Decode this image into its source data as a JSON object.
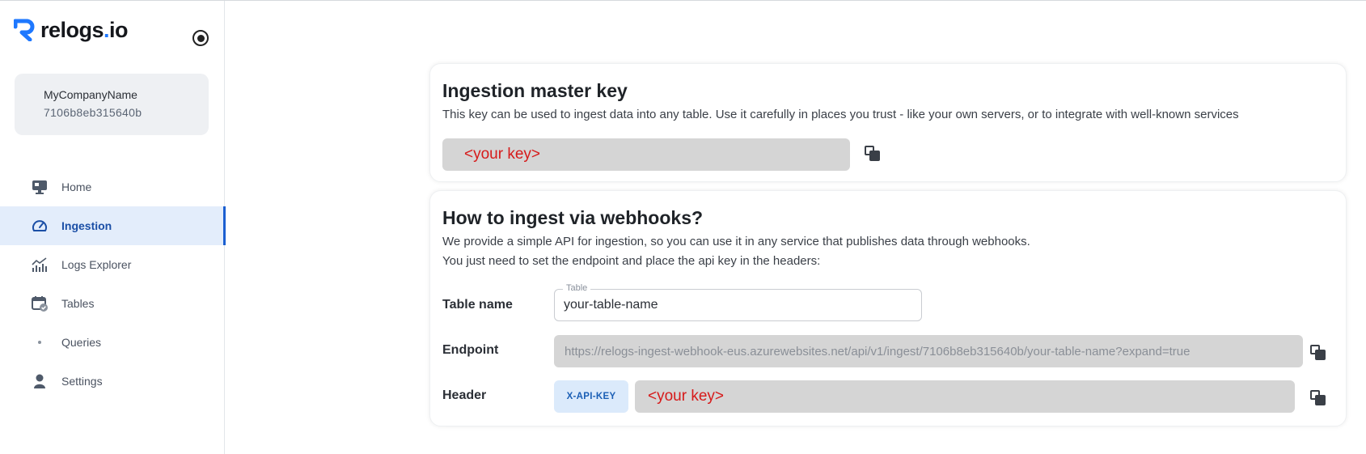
{
  "app": {
    "logo_text_main": "relogs",
    "logo_text_dot": ".",
    "logo_text_tail": "io",
    "brand_color": "#1e78ff"
  },
  "company": {
    "name": "MyCompanyName",
    "id": "7106b8eb315640b"
  },
  "sidebar": {
    "items": [
      {
        "label": "Home",
        "icon": "monitor-icon",
        "active": false
      },
      {
        "label": "Ingestion",
        "icon": "gauge-icon",
        "active": true
      },
      {
        "label": "Logs Explorer",
        "icon": "chart-icon",
        "active": false
      },
      {
        "label": "Tables",
        "icon": "calendar-check-icon",
        "active": false
      },
      {
        "label": "Queries",
        "icon": "dot-icon",
        "active": false
      },
      {
        "label": "Settings",
        "icon": "person-icon",
        "active": false
      }
    ]
  },
  "master_key": {
    "title": "Ingestion master key",
    "description": "This key can be used to ingest data into any table. Use it carefully in places you trust - like your own servers, or to integrate with well-known services",
    "key_value": "<your key>"
  },
  "webhooks": {
    "title": "How to ingest via webhooks?",
    "line1": "We provide a simple API for ingestion, so you can use it in any service that publishes data through webhooks.",
    "line2": "You just need to set the endpoint and place the api key in the headers:",
    "table_label": "Table name",
    "table_legend": "Table",
    "table_value": "your-table-name",
    "endpoint_label": "Endpoint",
    "endpoint_value": "https://relogs-ingest-webhook-eus.azurewebsites.net/api/v1/ingest/7106b8eb315640b/your-table-name?expand=true",
    "header_label": "Header",
    "header_name": "X-API-KEY",
    "header_value": "<your key>"
  }
}
